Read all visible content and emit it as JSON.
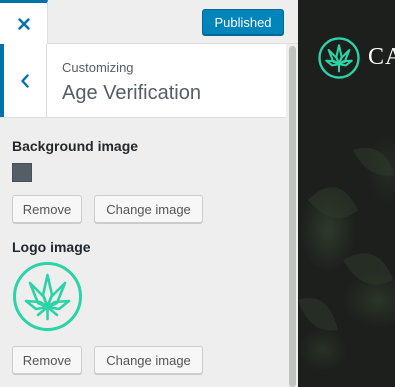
{
  "topbar": {
    "close_icon": "close-icon",
    "publish_label": "Published",
    "accent": "#0085ba"
  },
  "section": {
    "back_icon": "chevron-left-icon",
    "crumb": "Customizing",
    "title": "Age Verification"
  },
  "background_image": {
    "label": "Background image",
    "remove_label": "Remove",
    "change_label": "Change image"
  },
  "logo_image": {
    "label": "Logo image",
    "remove_label": "Remove",
    "change_label": "Change image",
    "logo_color": "#2bd3a6"
  },
  "preview": {
    "brand_text": "CA",
    "background": "#1d1f1d"
  }
}
